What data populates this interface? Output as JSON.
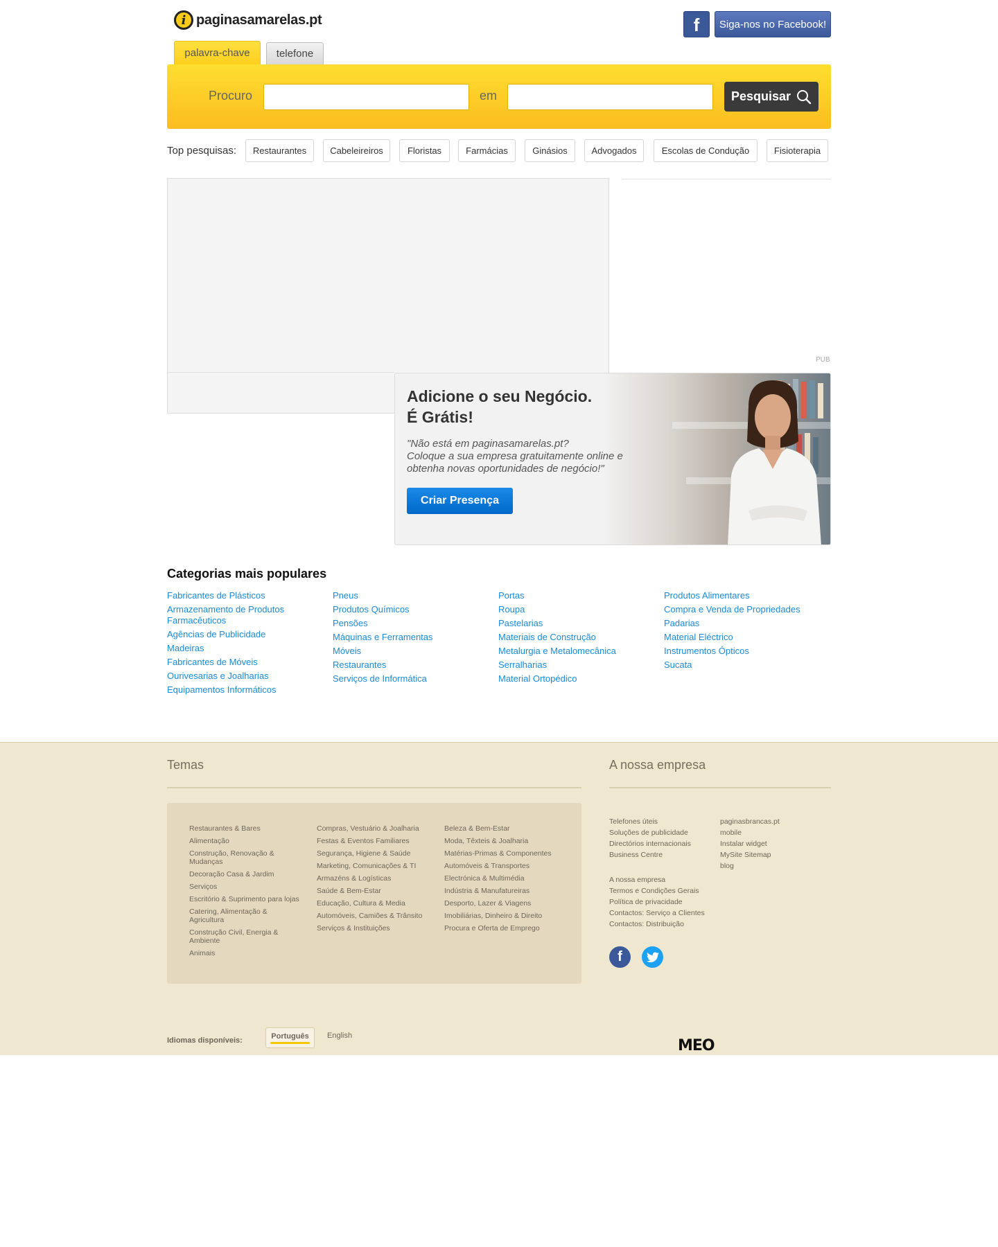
{
  "header": {
    "logo_text": "paginasamarelas.pt",
    "facebook_icon": "f",
    "facebook_follow": "Siga-nos no Facebook!"
  },
  "tabs": [
    {
      "label": "palavra-chave",
      "active": true
    },
    {
      "label": "telefone",
      "active": false
    }
  ],
  "search": {
    "what_label": "Procuro",
    "where_label": "em",
    "what_value": "",
    "where_value": "",
    "button_label": "Pesquisar"
  },
  "top_searches": {
    "label": "Top pesquisas:",
    "items": [
      "Restaurantes",
      "Cabeleireiros",
      "Floristas",
      "Farmácias",
      "Ginásios",
      "Advogados",
      "Escolas de Condução",
      "Fisioterapia"
    ]
  },
  "ad": {
    "pub_label": "PUB"
  },
  "promo": {
    "title_line1": "Adicione o seu Negócio.",
    "title_line2": "É Grátis!",
    "quote": "\"Não está em paginasamarelas.pt?\nColoque a sua empresa gratuitamente online e obtenha novas oportunidades de negócio!\"",
    "button": "Criar Presença"
  },
  "categories": {
    "title": "Categorias mais populares",
    "columns": [
      [
        "Fabricantes de Plásticos",
        "Armazenamento de Produtos Farmacêuticos",
        "Agências de Publicidade",
        "Madeiras",
        "Fabricantes de Móveis",
        "Ourivesarias e Joalharias",
        "Equipamentos Informáticos"
      ],
      [
        "Pneus",
        "Produtos Químicos",
        "Pensões",
        "Máquinas e Ferramentas",
        "Móveis",
        "Restaurantes",
        "Serviços de Informática"
      ],
      [
        "Portas",
        "Roupa",
        "Pastelarias",
        "Materiais de Construção",
        "Metalurgia e Metalomecânica",
        "Serralharias",
        "Material Ortopédico"
      ],
      [
        "Produtos Alimentares",
        "Compra e Venda de Propriedades",
        "Padarias",
        "Material Eléctrico",
        "Instrumentos Ópticos",
        "Sucata"
      ]
    ]
  },
  "footer": {
    "temas_title": "Temas",
    "empresa_title": "A nossa empresa",
    "temas_columns": [
      [
        "Restaurantes & Bares",
        "Alimentação",
        "Construção, Renovação & Mudanças",
        "Decoração Casa & Jardim",
        "Serviços",
        "Escritório & Suprimento para lojas",
        "Catering, Alimentação & Agricultura",
        "Construção Civil, Energia & Ambiente",
        "Animais"
      ],
      [
        "Compras, Vestuário & Joalharia",
        "Festas & Eventos Familiares",
        "Segurança, Higiene & Saúde",
        "Marketing, Comunicações & TI",
        "Armazéns & Logísticas",
        "Saúde & Bem-Estar",
        "Educação, Cultura & Media",
        "Automóveis, Camiões & Trânsito",
        "Serviços & Instituições"
      ],
      [
        "Beleza & Bem-Estar",
        "Moda, Têxteis & Joalharia",
        "Matérias-Primas & Componentes",
        "Automóveis & Transportes",
        "Electrónica & Multimédia",
        "Indústria & Manufatureiras",
        "Desporto, Lazer & Viagens",
        "Imobiliárias, Dinheiro & Direito",
        "Procura e Oferta de Emprego"
      ]
    ],
    "empresa_col1": [
      "Telefones úteis",
      "Soluções de publicidade",
      "Directórios internacionais",
      "Business Centre"
    ],
    "empresa_col2": [
      "paginasbrancas.pt",
      "mobile",
      "Instalar widget",
      "MySite Sitemap",
      "blog"
    ],
    "empresa_col3": [
      "A nossa empresa",
      "Termos e Condições Gerais",
      "Política de privacidade",
      "Contactos: Serviço a Clientes",
      "Contactos: Distribuição"
    ],
    "social": [
      {
        "icon": "facebook-icon",
        "glyph": "f",
        "color": "#3b5998"
      },
      {
        "icon": "twitter-icon",
        "glyph": "t",
        "color": "#1da1f2"
      }
    ],
    "languages_label": "Idiomas disponíveis:",
    "languages": [
      {
        "label": "Português",
        "active": true
      },
      {
        "label": "English",
        "active": false
      }
    ],
    "brand": "MEO"
  }
}
